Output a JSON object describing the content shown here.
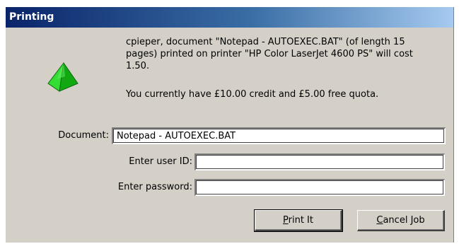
{
  "window": {
    "title": "Printing"
  },
  "icon": "green-pyramid-icon",
  "message": {
    "line1": "cpieper, document \"Notepad - AUTOEXEC.BAT\" (of length 15",
    "line2": "pages) printed on printer \"HP Color LaserJet 4600 PS\" will cost",
    "line3": "1.50.",
    "credit": "You currently have £10.00 credit and £5.00 free quota."
  },
  "form": {
    "document_label": "Document:",
    "document_value": "Notepad - AUTOEXEC.BAT",
    "userid_label": "Enter user ID:",
    "userid_value": "",
    "password_label": "Enter password:",
    "password_value": ""
  },
  "buttons": {
    "print_mnemonic": "P",
    "print_rest": "rint It",
    "cancel_mnemonic": "C",
    "cancel_rest": "ancel Job"
  },
  "colors": {
    "title_start": "#0a246a",
    "title_end": "#a6caf0",
    "face": "#d4d0c8",
    "icon": "#22cc22"
  }
}
